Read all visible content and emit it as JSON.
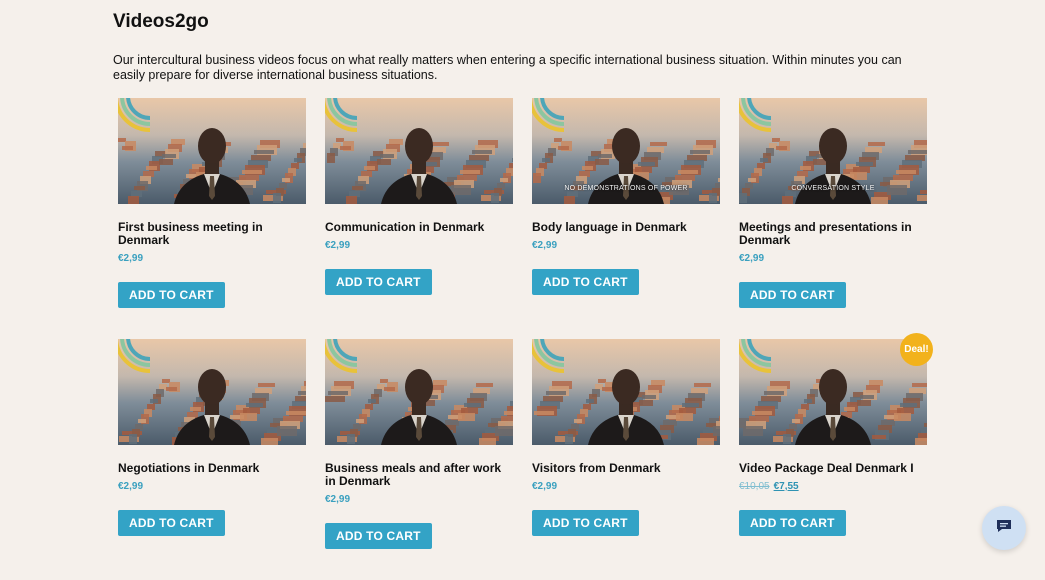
{
  "page": {
    "title": "Videos2go",
    "intro": "Our intercultural business videos focus on what really matters when entering a specific international business situation. Within minutes you can easily prepare for diverse international business situations."
  },
  "products": [
    {
      "name": "First business meeting in Denmark",
      "price": "€2,99",
      "button": "ADD TO CART",
      "caption": ""
    },
    {
      "name": "Communication in Denmark",
      "price": "€2,99",
      "button": "ADD TO CART",
      "caption": ""
    },
    {
      "name": "Body language in Denmark",
      "price": "€2,99",
      "button": "ADD TO CART",
      "caption": "NO DEMONSTRATIONS OF POWER"
    },
    {
      "name": "Meetings and presentations in Denmark",
      "price": "€2,99",
      "button": "ADD TO CART",
      "caption": "CONVERSATION STYLE"
    },
    {
      "name": "Negotiations in Denmark",
      "price": "€2,99",
      "button": "ADD TO CART",
      "caption": ""
    },
    {
      "name": "Business meals and after work in Denmark",
      "price": "€2,99",
      "button": "ADD TO CART",
      "caption": ""
    },
    {
      "name": "Visitors from Denmark",
      "price": "€2,99",
      "button": "ADD TO CART",
      "caption": ""
    },
    {
      "name": "Video Package Deal Denmark I",
      "old_price": "€10,05",
      "price": "€7,55",
      "button": "ADD TO CART",
      "badge": "Deal!",
      "caption": ""
    }
  ],
  "icons": {
    "chat": "chat-bubble-icon"
  },
  "colors": {
    "background": "#f5f0eb",
    "button": "#33a3c6",
    "price": "#3aa0bf",
    "badge": "#f2b21c"
  }
}
